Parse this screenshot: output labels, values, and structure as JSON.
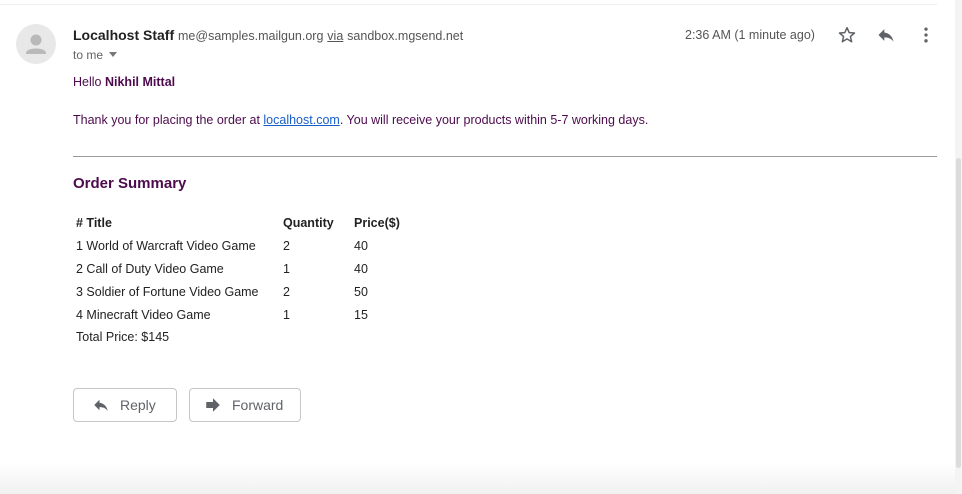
{
  "header": {
    "sender_name": "Localhost Staff",
    "sender_email": "me@samples.mailgun.org",
    "via_label": "via",
    "via_domain": "sandbox.mgsend.net",
    "recipient_label": "to me",
    "timestamp": "2:36 AM (1 minute ago)",
    "icons": [
      "star-icon",
      "reply-icon",
      "more-vert-icon"
    ]
  },
  "body": {
    "greeting": "Hello",
    "customer_name": "Nikhil Mittal",
    "intro_before_link": "Thank you for placing the order at ",
    "link_text": "localhost.com",
    "intro_after_link": ". You will receive your products within 5-7 working days.",
    "summary_title": "Order Summary",
    "table": {
      "headers": [
        "# Title",
        "Quantity",
        "Price($)"
      ],
      "rows": [
        [
          "1 World of Warcraft Video Game",
          "2",
          "40"
        ],
        [
          "2 Call of Duty Video Game",
          "1",
          "40"
        ],
        [
          "3 Soldier of Fortune Video Game",
          "2",
          "50"
        ],
        [
          "4 Minecraft Video Game",
          "1",
          "15"
        ]
      ]
    },
    "total": "Total Price: $145"
  },
  "actions": {
    "reply_label": "Reply",
    "forward_label": "Forward"
  },
  "colors": {
    "body_text": "#4d0b4e",
    "link": "#1a5fc9",
    "muted": "#5f6368"
  }
}
